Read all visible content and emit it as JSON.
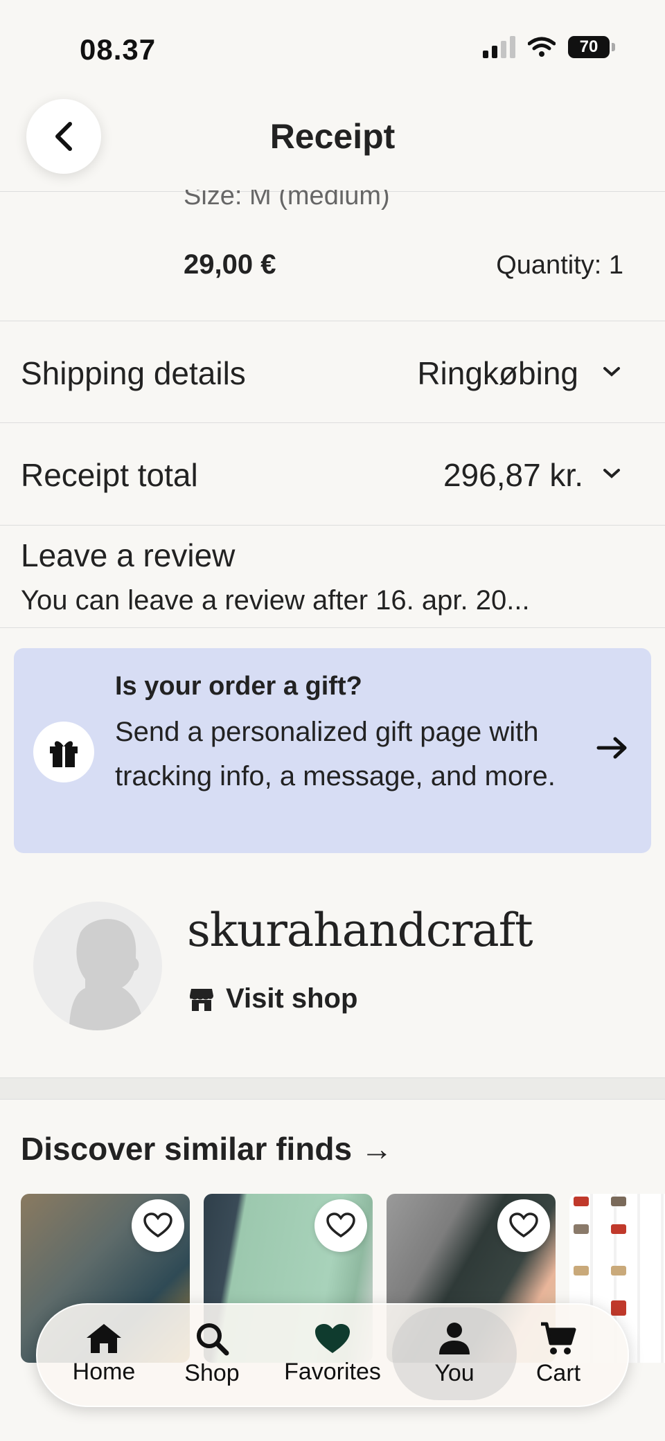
{
  "status_bar": {
    "time": "08.37",
    "battery": "70"
  },
  "header": {
    "title": "Receipt"
  },
  "item": {
    "size_text": "Size: M (medium)",
    "price": "29,00 €",
    "quantity": "Quantity: 1"
  },
  "shipping": {
    "label": "Shipping details",
    "value": "Ringkøbing"
  },
  "total": {
    "label": "Receipt total",
    "value": "296,87 kr."
  },
  "review": {
    "title": "Leave a review",
    "subtitle": "You can leave a review after 16. apr. 20..."
  },
  "gift": {
    "title": "Is your order a gift?",
    "body": "Send a personalized gift page with tracking info, a message, and more.",
    "background": "#d7ddf4"
  },
  "shop": {
    "name": "skurahandcraft",
    "visit_label": "Visit shop"
  },
  "discover": {
    "title": "Discover similar finds →"
  },
  "tabs": [
    {
      "label": "Home",
      "icon": "home-icon"
    },
    {
      "label": "Shop",
      "icon": "search-icon"
    },
    {
      "label": "Favorites",
      "icon": "heart-icon"
    },
    {
      "label": "You",
      "icon": "person-icon",
      "active": true
    },
    {
      "label": "Cart",
      "icon": "cart-icon"
    }
  ],
  "colors": {
    "background": "#f8f7f4",
    "favorites_heart": "#0f3b2e"
  }
}
